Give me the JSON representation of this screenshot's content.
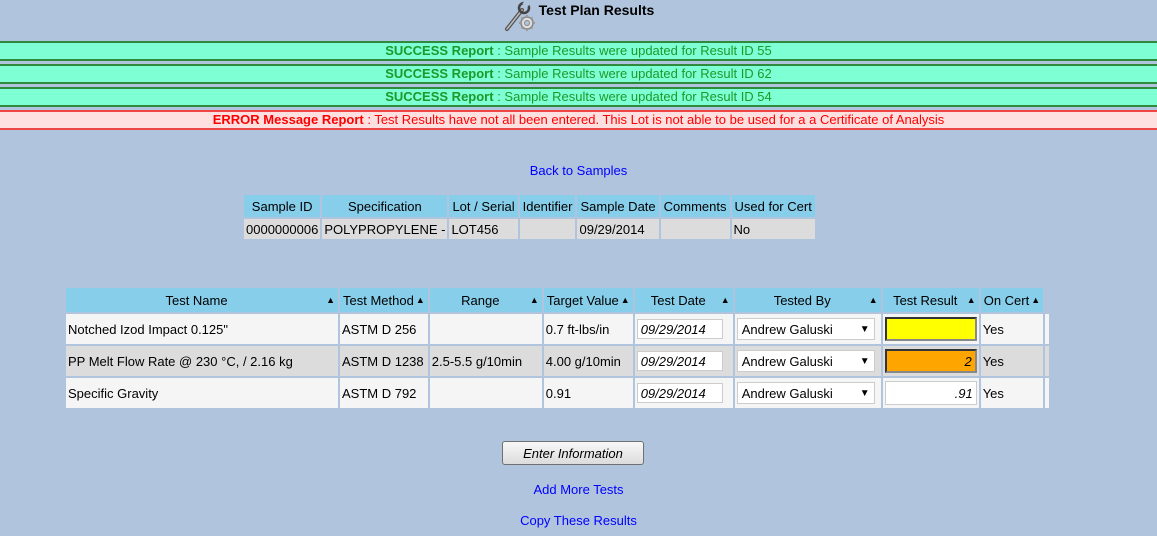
{
  "header": {
    "title": "Test Plan Results",
    "icon": "wrench-gear-icon"
  },
  "messages": [
    {
      "type": "success",
      "label": "SUCCESS Report",
      "text": " : Sample Results were updated for Result ID 55"
    },
    {
      "type": "success",
      "label": "SUCCESS Report",
      "text": " : Sample Results were updated for Result ID 62"
    },
    {
      "type": "success",
      "label": "SUCCESS Report",
      "text": " : Sample Results were updated for Result ID 54"
    },
    {
      "type": "error",
      "label": "ERROR Message Report",
      "text": " : Test Results have not all been entered. This Lot is not able to be used for a a Certificate of Analysis"
    }
  ],
  "links": {
    "back": "Back to Samples",
    "add_more": "Add More Tests",
    "copy": "Copy These Results"
  },
  "sample": {
    "headers": [
      "Sample ID",
      "Specification",
      "Lot / Serial",
      "Identifier",
      "Sample Date",
      "Comments",
      "Used for Cert"
    ],
    "row": [
      "0000000006",
      "POLYPROPYLENE -",
      "LOT456",
      "",
      "09/29/2014",
      "",
      "No"
    ]
  },
  "tests": {
    "headers": [
      "Test Name",
      "Test Method",
      "Range",
      "Target Value",
      "Test Date",
      "Tested By",
      "Test Result",
      "On Cert"
    ],
    "sort_glyph": "▲",
    "rows": [
      {
        "name": "Notched Izod Impact 0.125\"",
        "method": "ASTM D 256",
        "range": "",
        "target": "0.7 ft-lbs/in",
        "date": "09/29/2014",
        "tested_by": "Andrew Galuski",
        "result": "",
        "result_color": "#ffff00",
        "on_cert": "Yes"
      },
      {
        "name": "PP Melt Flow Rate @ 230 °C, / 2.16 kg",
        "method": "ASTM D 1238",
        "range": "2.5-5.5 g/10min",
        "target": "4.00 g/10min",
        "date": "09/29/2014",
        "tested_by": "Andrew Galuski",
        "result": "2",
        "result_color": "#ffa500",
        "on_cert": "Yes"
      },
      {
        "name": "Specific Gravity",
        "method": "ASTM D 792",
        "range": "",
        "target": "0.91",
        "date": "09/29/2014",
        "tested_by": "Andrew Galuski",
        "result": ".91",
        "result_color": "#ffffff",
        "on_cert": "Yes"
      }
    ]
  },
  "buttons": {
    "enter": "Enter Information"
  }
}
